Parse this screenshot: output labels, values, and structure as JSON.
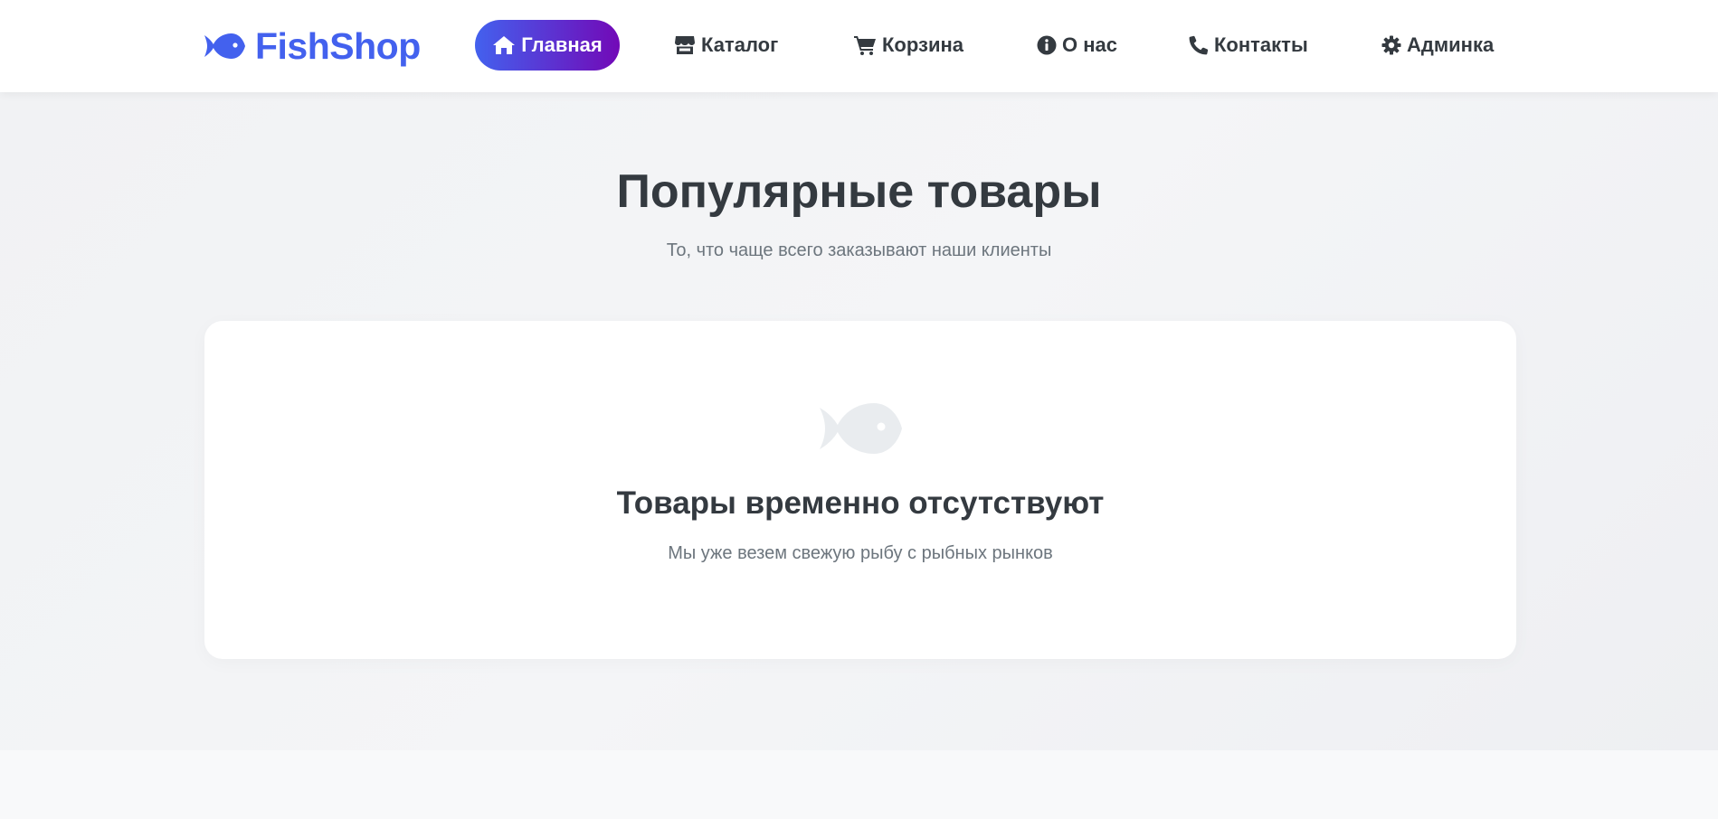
{
  "brand": {
    "name": "FishShop",
    "icon": "fish-icon"
  },
  "nav": {
    "items": [
      {
        "label": "Главная",
        "icon": "home-icon",
        "active": true
      },
      {
        "label": "Каталог",
        "icon": "store-icon",
        "active": false
      },
      {
        "label": "Корзина",
        "icon": "cart-icon",
        "active": false
      },
      {
        "label": "О нас",
        "icon": "info-circle-icon",
        "active": false
      },
      {
        "label": "Контакты",
        "icon": "phone-icon",
        "active": false
      },
      {
        "label": "Админка",
        "icon": "gear-icon",
        "active": false
      }
    ]
  },
  "popular": {
    "title": "Популярные товары",
    "subtitle": "То, что чаще всего заказывают наши клиенты",
    "empty": {
      "icon": "fish-icon",
      "title": "Товары временно отсутствуют",
      "text": "Мы уже везем свежую рыбу с рыбных рынков"
    }
  },
  "colors": {
    "brand": "#4361ee",
    "accent_gradient_start": "#4361ee",
    "accent_gradient_end": "#7209b7",
    "text": "#343a40",
    "muted": "#6c757d",
    "empty_icon": "#e9ecef"
  }
}
